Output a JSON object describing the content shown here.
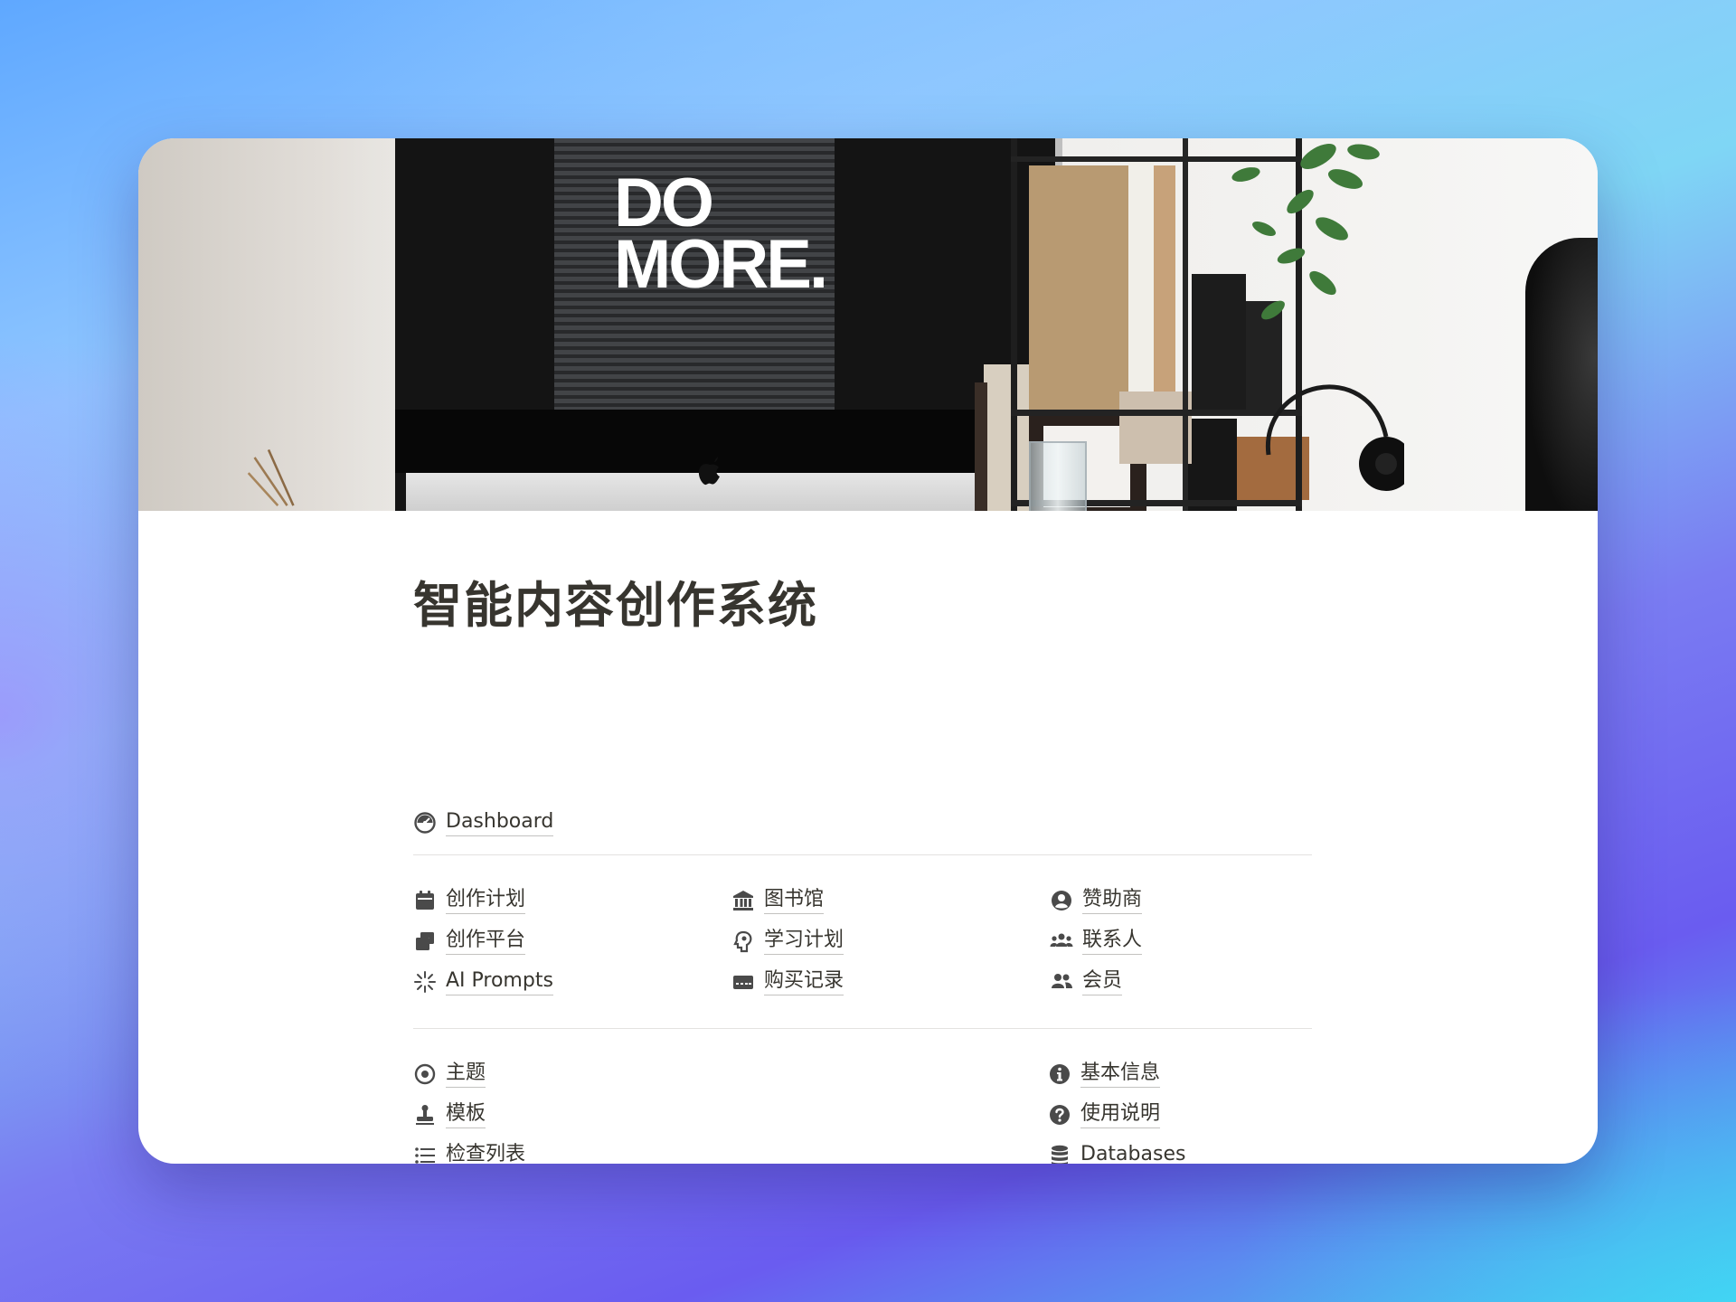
{
  "cover": {
    "monitor_text_line1": "DO",
    "monitor_text_line2": "MORE."
  },
  "page": {
    "title": "智能内容创作系统"
  },
  "dashboard": {
    "label": "Dashboard",
    "icon": "dashboard-gauge-icon"
  },
  "grid": {
    "col1": [
      {
        "label": "创作计划",
        "icon": "calendar-icon"
      },
      {
        "label": "创作平台",
        "icon": "window-stack-icon"
      },
      {
        "label": "AI Prompts",
        "icon": "sparkle-burst-icon"
      }
    ],
    "col2": [
      {
        "label": "图书馆",
        "icon": "library-building-icon"
      },
      {
        "label": "学习计划",
        "icon": "brain-head-icon"
      },
      {
        "label": "购买记录",
        "icon": "credit-card-icon"
      }
    ],
    "col3": [
      {
        "label": "赞助商",
        "icon": "user-circle-icon"
      },
      {
        "label": "联系人",
        "icon": "users-group-icon"
      },
      {
        "label": "会员",
        "icon": "two-users-icon"
      }
    ]
  },
  "bottom": {
    "left": [
      {
        "label": "主题",
        "icon": "target-icon"
      },
      {
        "label": "模板",
        "icon": "stamp-icon"
      },
      {
        "label": "检查列表",
        "icon": "bulleted-list-icon"
      }
    ],
    "right": [
      {
        "label": "基本信息",
        "icon": "info-circle-icon"
      },
      {
        "label": "使用说明",
        "icon": "question-circle-icon"
      },
      {
        "label": "Databases",
        "icon": "database-icon"
      }
    ]
  },
  "colors": {
    "text": "#37352f",
    "icon": "#4a4a4a",
    "divider": "#e3e2e0",
    "card": "#ffffff"
  }
}
